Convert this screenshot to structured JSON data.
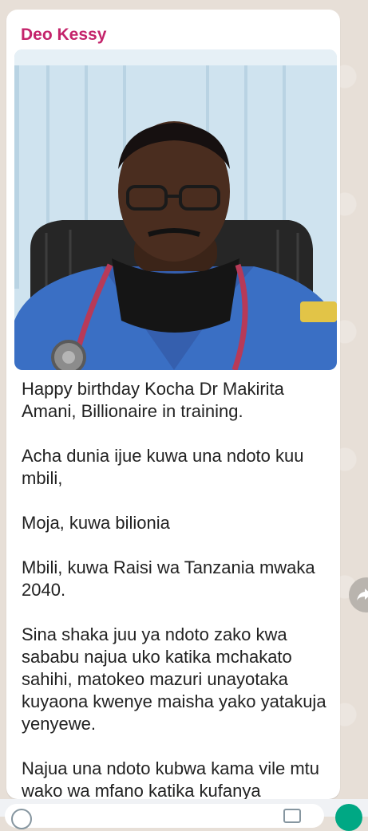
{
  "message": {
    "sender": "Deo Kessy",
    "paragraphs": [
      "Happy birthday Kocha Dr Makirita Amani, Billionaire in training.",
      "Acha dunia ijue kuwa una ndoto kuu mbili,",
      "Moja, kuwa bilionia",
      "Mbili, kuwa Raisi wa Tanzania mwaka 2040.",
      "Sina shaka juu ya ndoto zako kwa sababu najua uko katika mchakato sahihi, matokeo mazuri unayotaka kuyaona kwenye maisha yako yatakuja yenyewe.",
      "Najua una ndoto kubwa kama vile mtu wako wa mfano katika kufanya"
    ]
  },
  "colors": {
    "sender_name": "#c4246b",
    "bubble": "#ffffff",
    "chat_background": "#e7dfd7",
    "scrub_color": "#3a6fc4"
  },
  "icons": {
    "share": "share-forward-icon",
    "emoji": "emoji-icon",
    "camera": "camera-icon",
    "mic": "mic-icon"
  }
}
